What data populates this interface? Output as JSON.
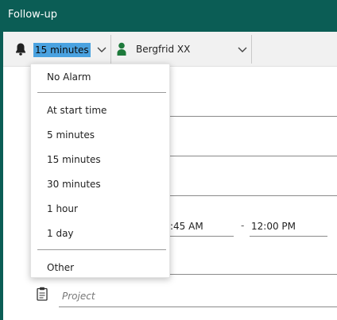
{
  "window": {
    "title": "Follow-up"
  },
  "toolbar": {
    "alarm_value": "15 minutes",
    "owner_name": "Bergfrid XX"
  },
  "form": {
    "start_time": ":45 AM",
    "time_separator": "-",
    "end_time": "12:00 PM",
    "project_placeholder": "Project"
  },
  "alarm_menu": {
    "items": [
      "No Alarm",
      "At start time",
      "5 minutes",
      "15 minutes",
      "30 minutes",
      "1 hour",
      "1 day",
      "Other"
    ]
  },
  "colors": {
    "title_bar": "#0b5d55",
    "selection": "#4aa2e0",
    "person_icon": "#1e7a3c"
  },
  "icons": [
    "bell-icon",
    "chevron-down-icon",
    "person-icon",
    "clipboard-icon"
  ]
}
